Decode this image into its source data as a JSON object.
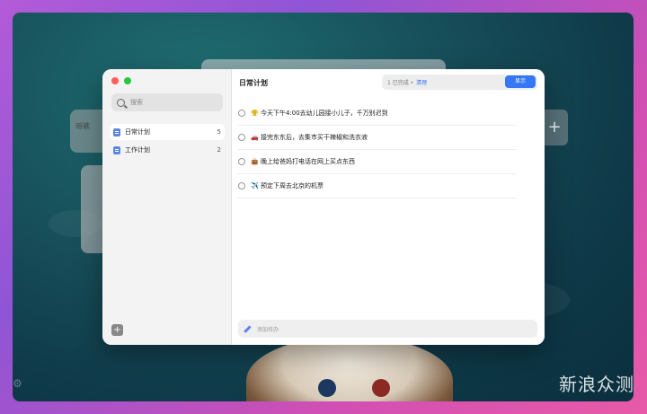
{
  "sidebar": {
    "search_placeholder": "搜索",
    "lists": [
      {
        "name": "日常计划",
        "count": "5"
      },
      {
        "name": "工作计划",
        "count": "2"
      }
    ],
    "add_list_label": "+"
  },
  "main": {
    "title": "日常计划",
    "completed_text": "1 已完成 •",
    "clear_label": "清理",
    "show_label": "显示",
    "tasks": [
      {
        "text": "😤 今天下午4:00去幼儿园接小儿子，千万别迟到"
      },
      {
        "text": "🚗 接完东东后，去集市买干辣椒和洗衣液"
      },
      {
        "text": "👜 晚上给爸妈打电话在网上买点东西"
      },
      {
        "text": "✈️ 预定下周去北京的机票"
      }
    ],
    "add_placeholder": "添加待办"
  },
  "background": {
    "widget_left_text": "暗礁",
    "right_plus": "+",
    "watermark": "新浪众测"
  },
  "colors": {
    "accent": "#3478f6",
    "list_icon": "#5b84e6",
    "close": "#ff5f57",
    "zoom": "#28c840"
  }
}
